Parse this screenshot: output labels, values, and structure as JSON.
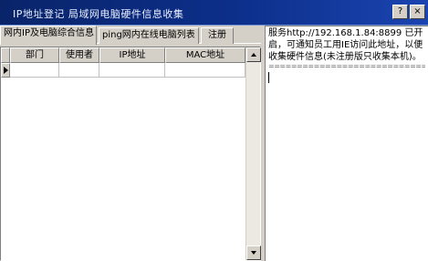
{
  "window": {
    "title": "IP地址登记 局域网电脑硬件信息收集",
    "help_button": "?",
    "close_button": "×"
  },
  "tabs": [
    {
      "label": "网内IP及电脑综合信息",
      "active": true
    },
    {
      "label": "ping网内在线电脑列表",
      "active": false
    },
    {
      "label": "注册",
      "active": false
    }
  ],
  "table": {
    "columns": [
      "",
      "部门",
      "使用者",
      "IP地址",
      "MAC地址"
    ],
    "rows": [
      [
        "",
        "",
        "",
        ""
      ]
    ]
  },
  "log": {
    "message": "服务http://192.168.1.84:8899 已开启，可通知员工用IE访问此地址，以便收集硬件信息(未注册版只收集本机)。",
    "separator": "==========================================="
  },
  "colors": {
    "titlebar": "#0a246a",
    "face": "#d4d0c8"
  },
  "icons": {
    "help": "help-icon",
    "close": "close-icon",
    "row_pointer": "row-pointer-icon"
  }
}
